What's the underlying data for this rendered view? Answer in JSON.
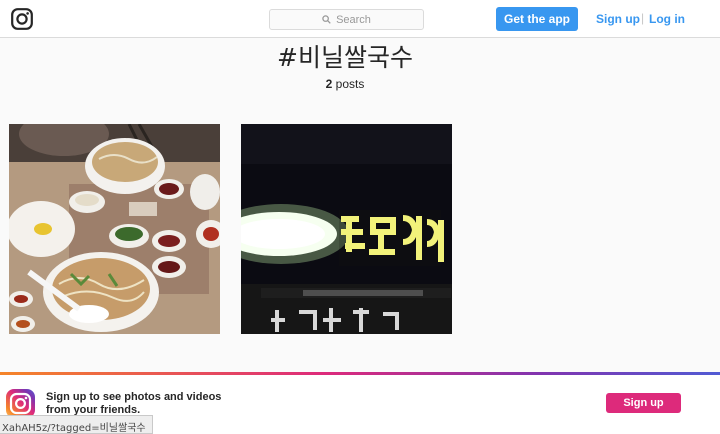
{
  "header": {
    "logo_icon": "instagram-camera-icon",
    "search_icon": "search-icon",
    "search_placeholder": "Search",
    "get_app_label": "Get the app",
    "signup_label": "Sign up",
    "separator": "|",
    "login_label": "Log in",
    "accent_color": "#3897f0"
  },
  "main": {
    "title": "#비닐쌀국수",
    "post_count": "2",
    "post_suffix": " posts",
    "posts": [
      {
        "kind": "food-photo"
      },
      {
        "kind": "night-sign-photo"
      }
    ]
  },
  "banner": {
    "logo_icon": "instagram-gradient-logo-icon",
    "text": "Sign up to see photos and videos from your friends.",
    "button_label": "Sign up",
    "button_color": "#dd2a7b"
  },
  "status_bar": {
    "url": "XahAH5z/?tagged=비닐쌀국수"
  }
}
